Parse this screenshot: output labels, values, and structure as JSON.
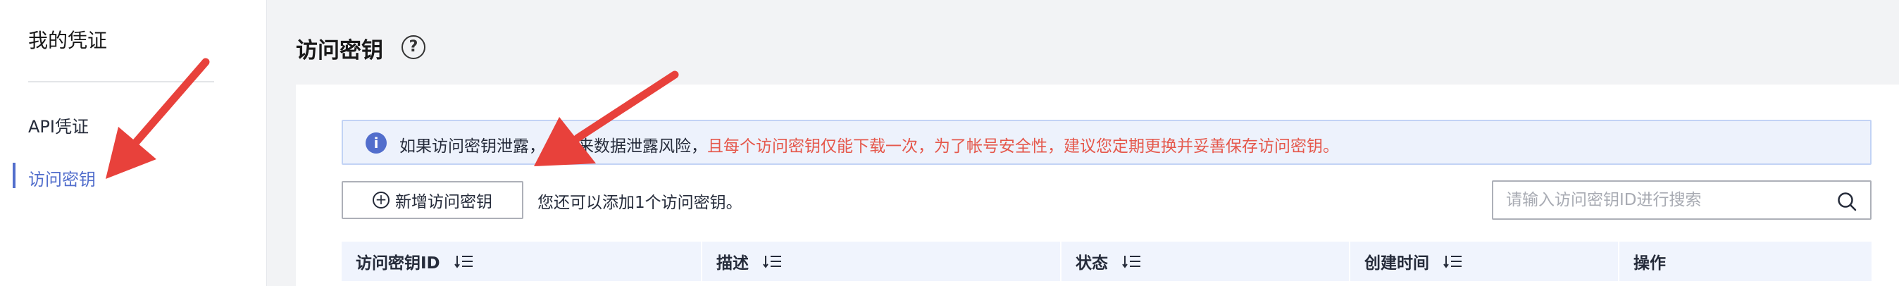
{
  "sidebar": {
    "title": "我的凭证",
    "items": [
      {
        "label": "API凭证"
      },
      {
        "label": "访问密钥"
      }
    ]
  },
  "header": {
    "title": "访问密钥",
    "help_icon": "?"
  },
  "notice": {
    "icon": "i",
    "text_normal": "如果访问密钥泄露，会带来数据泄露风险，",
    "text_red": "且每个访问密钥仅能下载一次，为了帐号安全性，建议您定期更换并妥善保存访问密钥。"
  },
  "toolbar": {
    "add_button_label": "新增访问密钥",
    "add_hint": "您还可以添加1个访问密钥。",
    "search_placeholder": "请输入访问密钥ID进行搜索"
  },
  "table": {
    "columns": [
      {
        "label": "访问密钥ID",
        "sortable": true
      },
      {
        "label": "描述",
        "sortable": true
      },
      {
        "label": "状态",
        "sortable": true
      },
      {
        "label": "创建时间",
        "sortable": true
      },
      {
        "label": "操作",
        "sortable": false
      }
    ]
  },
  "colors": {
    "accent": "#526ecc",
    "danger": "#e5584c",
    "annotation_arrow": "#e8413b"
  },
  "icons": [
    "help-icon",
    "info-icon",
    "plus-circle-icon",
    "search-icon",
    "sort-icon",
    "annotation-arrow"
  ]
}
